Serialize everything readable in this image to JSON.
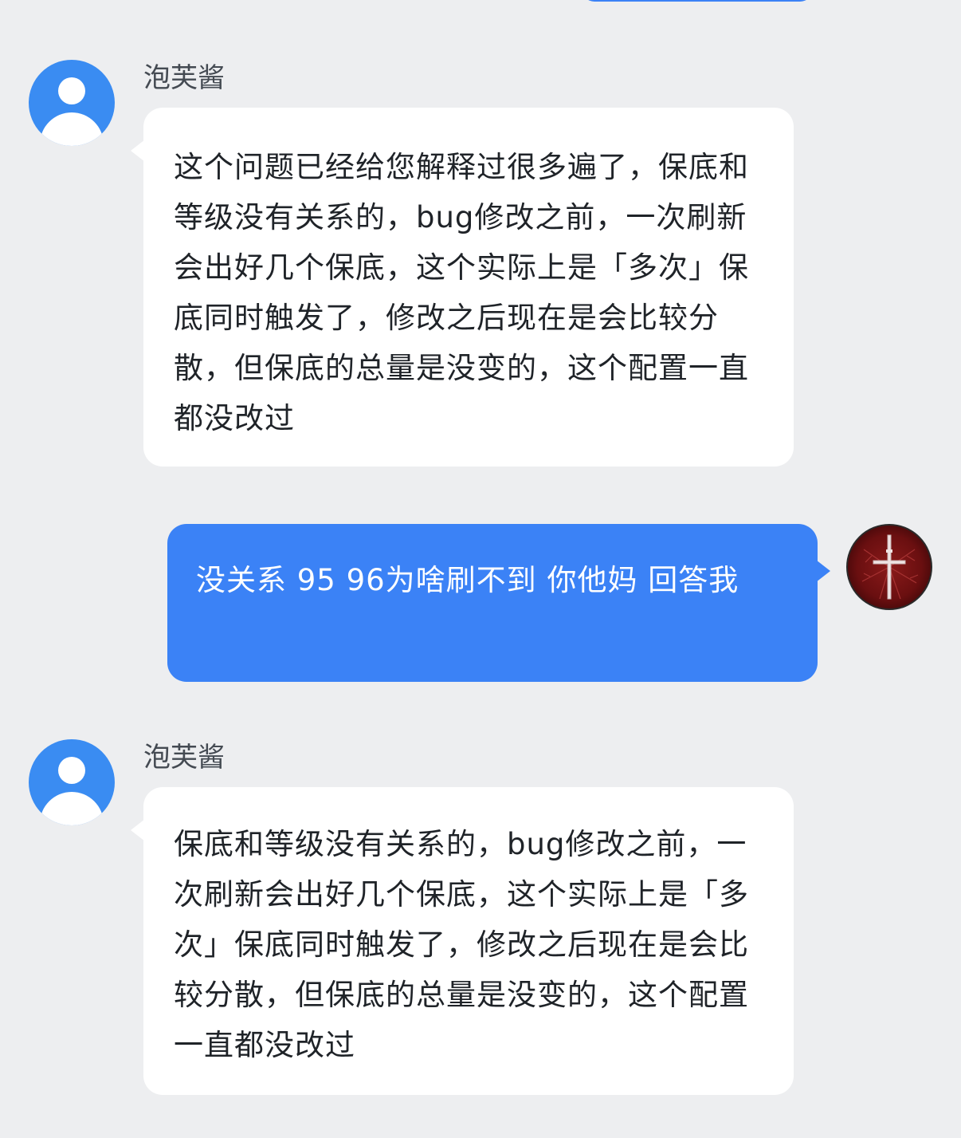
{
  "chat": {
    "messages": [
      {
        "side": "left",
        "sender": "泡芙酱",
        "avatar": "default-user-avatar-icon",
        "text": "这个问题已经给您解释过很多遍了，保底和等级没有关系的，bug修改之前，一次刷新会出好几个保底，这个实际上是「多次」保底同时触发了，修改之后现在是会比较分散，但保底的总量是没变的，这个配置一直都没改过"
      },
      {
        "side": "right",
        "avatar": "red-cross-emblem-avatar-icon",
        "text": "没关系  95   96为啥刷不到    你他妈  回答我"
      },
      {
        "side": "left",
        "sender": "泡芙酱",
        "avatar": "default-user-avatar-icon",
        "text": "保底和等级没有关系的，bug修改之前，一次刷新会出好几个保底，这个实际上是「多次」保底同时触发了，修改之后现在是会比较分散，但保底的总量是没变的，这个配置一直都没改过"
      }
    ]
  },
  "colors": {
    "background": "#edeef0",
    "incoming_bubble": "#ffffff",
    "outgoing_bubble": "#3b82f6",
    "default_avatar": "#3a8cf2"
  }
}
